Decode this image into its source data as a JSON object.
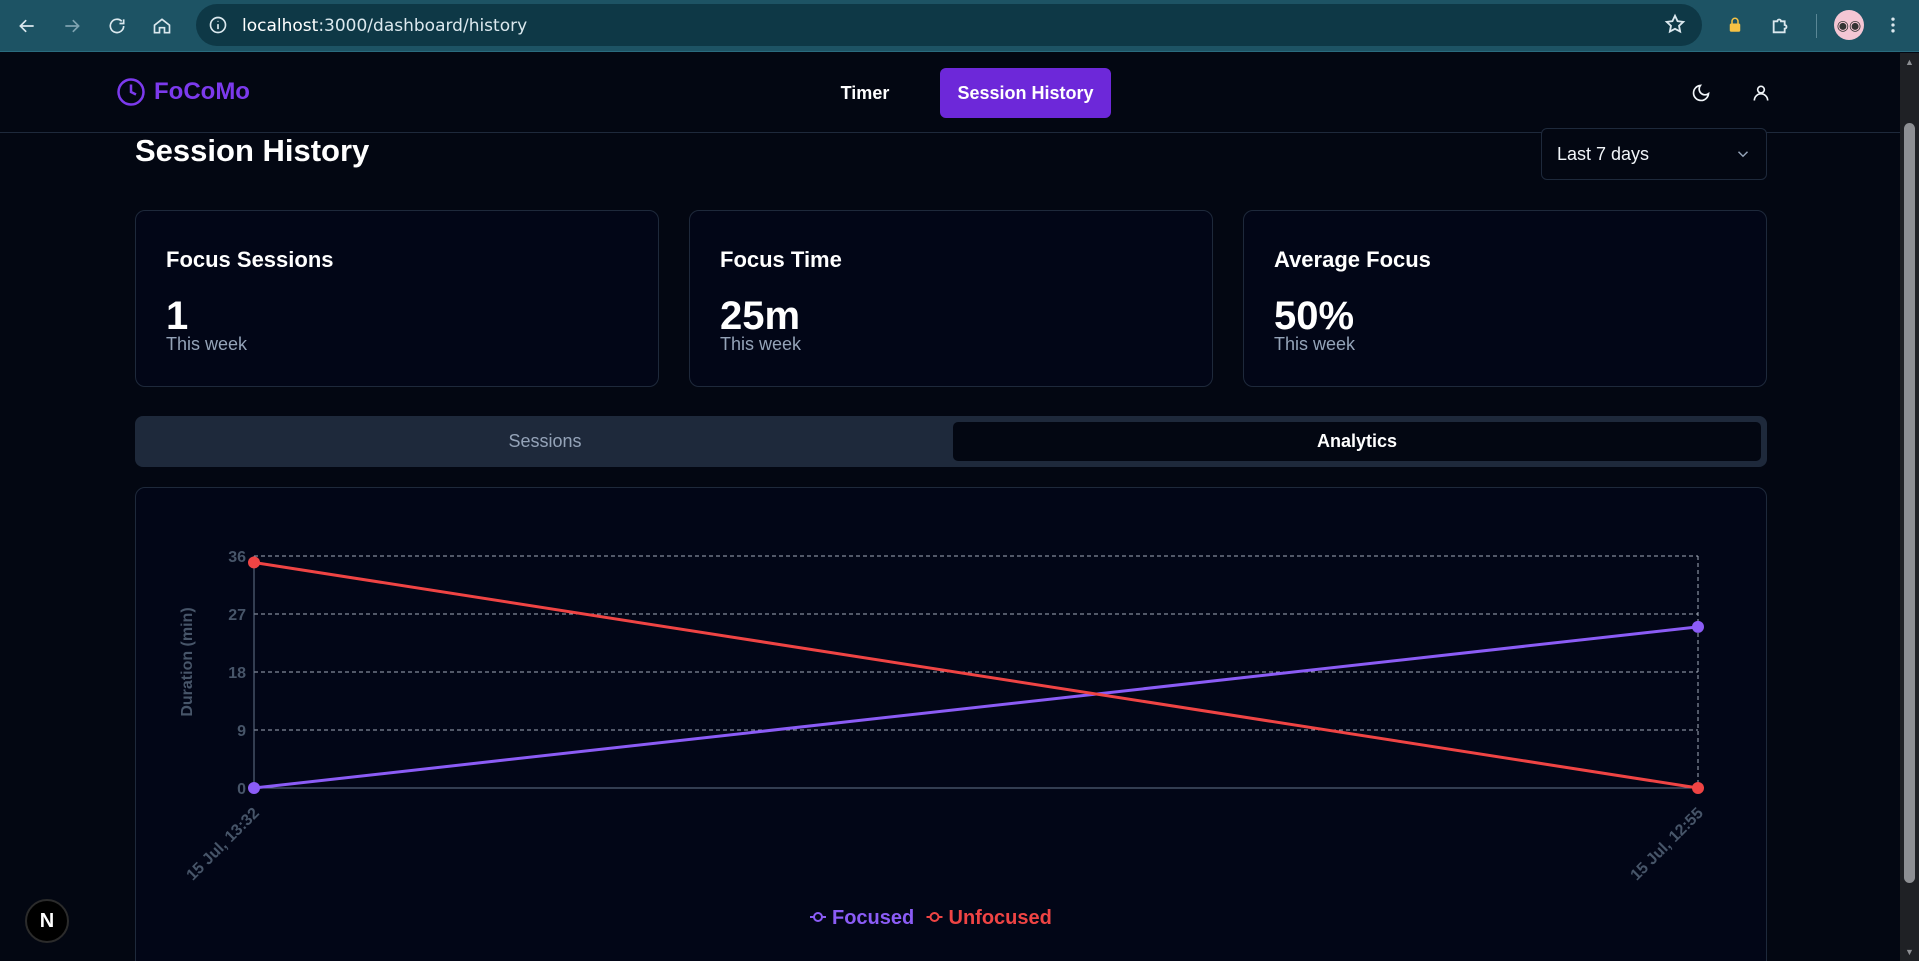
{
  "browser": {
    "url_host": "localhost",
    "url_path": ":3000/dashboard/history"
  },
  "app": {
    "logo_text": "FoCoMo",
    "nav": {
      "timer_label": "Timer",
      "history_label": "Session History"
    }
  },
  "page": {
    "title": "Session History",
    "range_select": {
      "value": "Last 7 days"
    }
  },
  "stats": [
    {
      "title": "Focus Sessions",
      "value": "1",
      "sub": "This week"
    },
    {
      "title": "Focus Time",
      "value": "25m",
      "sub": "This week"
    },
    {
      "title": "Average Focus",
      "value": "50%",
      "sub": "This week"
    }
  ],
  "tabs": {
    "sessions": "Sessions",
    "analytics": "Analytics"
  },
  "colors": {
    "focused": "#8b5cf6",
    "unfocused": "#ef4444",
    "accent": "#6d28d9"
  },
  "chart_data": {
    "type": "line",
    "ylabel": "Duration (min)",
    "xlabel": "",
    "x": [
      "15 Jul, 13:32",
      "15 Jul, 12:55"
    ],
    "ylim": [
      0,
      36
    ],
    "yticks": [
      "0",
      "9",
      "18",
      "27",
      "36"
    ],
    "grid": true,
    "legend": "bottom",
    "series": [
      {
        "name": "Focused",
        "values": [
          0,
          25
        ]
      },
      {
        "name": "Unfocused",
        "values": [
          35,
          0
        ]
      }
    ]
  },
  "badge": {
    "letter": "N"
  }
}
